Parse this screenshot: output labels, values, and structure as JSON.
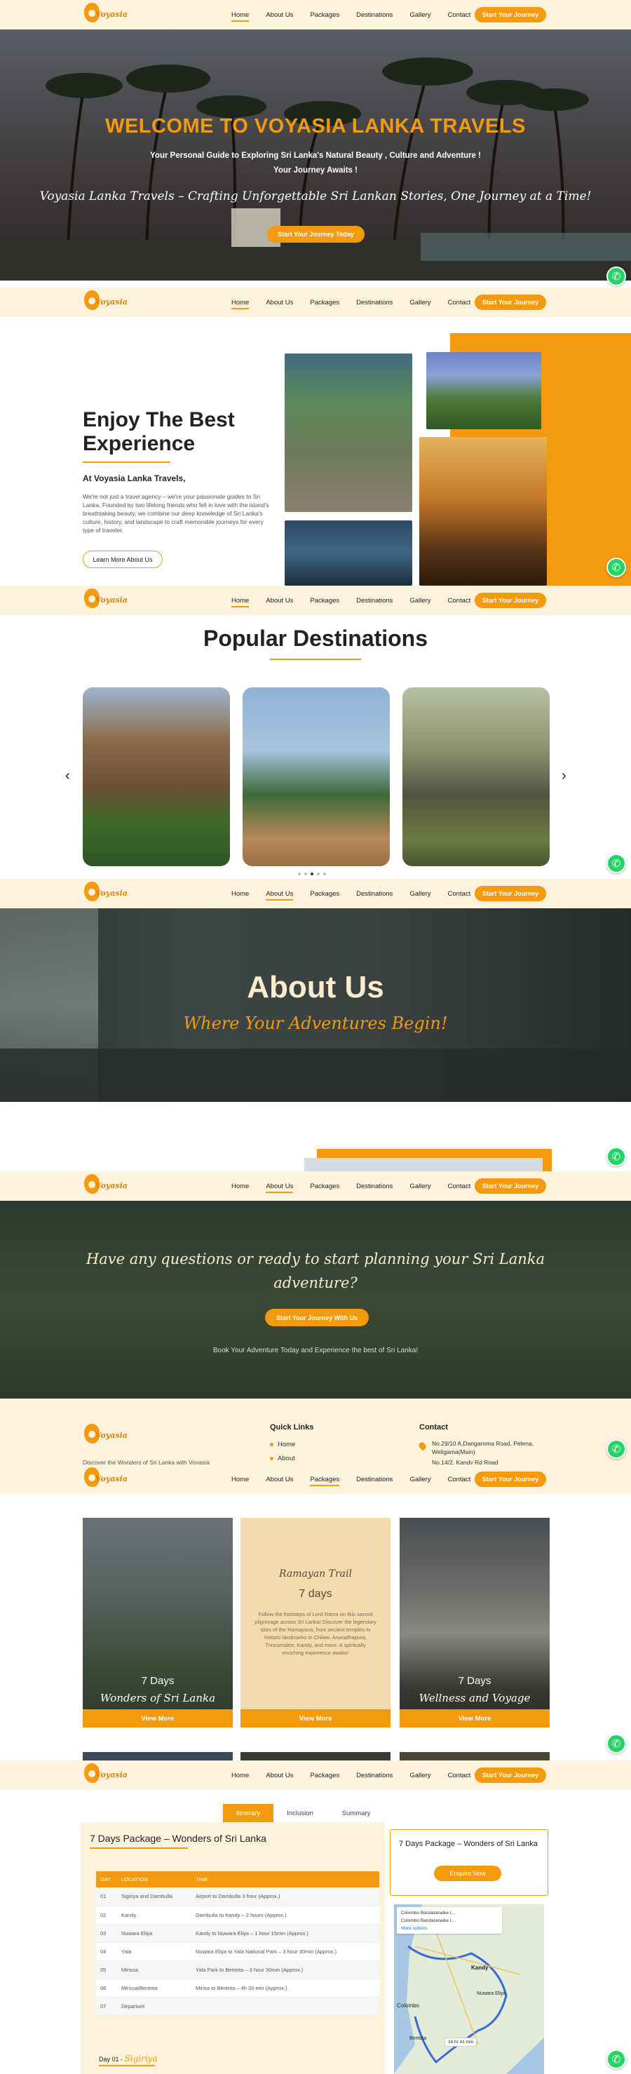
{
  "nav": {
    "logo_text": "Voyasia",
    "links": [
      "Home",
      "About Us",
      "Packages",
      "Destinations",
      "Gallery",
      "Contact"
    ],
    "cta": "Start Your Journey"
  },
  "hero": {
    "title": "WELCOME TO VOYASIA LANKA TRAVELS",
    "subtitle_line1": "Your Personal Guide to Exploring Sri Lanka's Natural Beauty , Culture and Adventure !",
    "subtitle_line2": "Your Journey Awaits !",
    "tagline": "Voyasia Lanka Travels – Crafting Unforgettable Sri Lankan Stories, One Journey at a Time!",
    "button": "Start Your Journey Today"
  },
  "about_section": {
    "title_line1": "Enjoy The Best",
    "title_line2": "Experience",
    "subtitle": "At Voyasia Lanka Travels,",
    "text": "We're not just a travel agency – we're your passionate guides to Sri Lanka. Founded by two lifelong friends who fell in love with the island's breathtaking beauty, we combine our deep knowledge of Sri Lanka's culture, history, and landscape to craft memorable journeys for every type of traveler.",
    "button": "Learn More About Us"
  },
  "destinations": {
    "title": "Popular Destinations",
    "prev": "‹",
    "next": "›",
    "dot_count": 5,
    "active_dot": 2
  },
  "about_page": {
    "title": "About Us",
    "subtitle": "Where Your Adventures Begin!"
  },
  "contact_page": {
    "question": "Have any questions or ready to start planning your Sri Lanka adventure?",
    "button": "Start Your Journey With Us",
    "small_text": "Book Your Adventure Today and Experience the best of Sri Lanka!",
    "footer": {
      "logo_text": "Voyasia",
      "tagline": "Discover the Wonders of Sri Lanka with Voyasia",
      "quick_links_title": "Quick Links",
      "quick_links": [
        "Home",
        "About"
      ],
      "contact_title": "Contact",
      "address": "No.29/10 A,Dangaroma Road, Pelena, Weligama(Main)",
      "address2": "No.14/2, Kandy Rd Road"
    }
  },
  "packages": {
    "items": [
      {
        "days": "7 Days",
        "name": "Wonders of Sri Lanka",
        "button": "View More"
      },
      {
        "name": "Ramayan Trail",
        "days": "7 days",
        "desc": "Follow the footsteps of Lord Rama on this sacred pilgrimage across Sri Lanka! Discover the legendary sites of the Ramayana, from ancient temples to historic landmarks in Chilaw, Anuradhapura, Trincomalee, Kandy, and more. A spiritually enriching experience awaits!",
        "button": "View More"
      },
      {
        "days": "7 Days",
        "name": "Wellness and Voyage",
        "button": "View More"
      }
    ]
  },
  "package_detail": {
    "tabs": [
      "Itinerary",
      "Inclusion",
      "Summary"
    ],
    "active_tab": 0,
    "title": "7 Days Package – Wonders of Sri Lanka",
    "columns": [
      "DAY",
      "LOCATION",
      "TIME"
    ],
    "rows": [
      [
        "01",
        "Sigiriya and Dambulla",
        "Airport to Dambulla 3 hour (Approx.)"
      ],
      [
        "02",
        "Kandy",
        "Dambulla to Kandy – 2 hours (Approx.)"
      ],
      [
        "03",
        "Nuwara Eliya",
        "Kandy to Nuwara Eliya – 1 hour 15min (Approx.)"
      ],
      [
        "04",
        "Yala",
        "Nuwara Eliya to Yala National Park – 3 hour 30min (Approx.)"
      ],
      [
        "05",
        "Mirissa",
        "Yala Park to Bentota – 3 hour 30min (Approx.)"
      ],
      [
        "06",
        "Mirissa/Bentota",
        "Mirisa to Bentota – 4h 30 min (Approx.)"
      ],
      [
        "07",
        "Departure",
        ""
      ]
    ],
    "day_label": "Day 01 -",
    "day_place": "Sigiriya",
    "side_title": "7 Days Package – Wonders of Sri Lanka",
    "side_button": "Enquire Now",
    "map": {
      "stop_a": "Colombo Bandaranaike I...",
      "stop_b": "Colombo Bandaranaike I...",
      "more": "More options",
      "route_time": "16 hr 41 min",
      "places": [
        "Kandy",
        "Nuwara Eliya",
        "Colombo",
        "Bentota"
      ]
    }
  },
  "colors": {
    "accent": "#f39a0f",
    "nav_bg": "#fdf3dc",
    "whatsapp": "#25d366"
  }
}
